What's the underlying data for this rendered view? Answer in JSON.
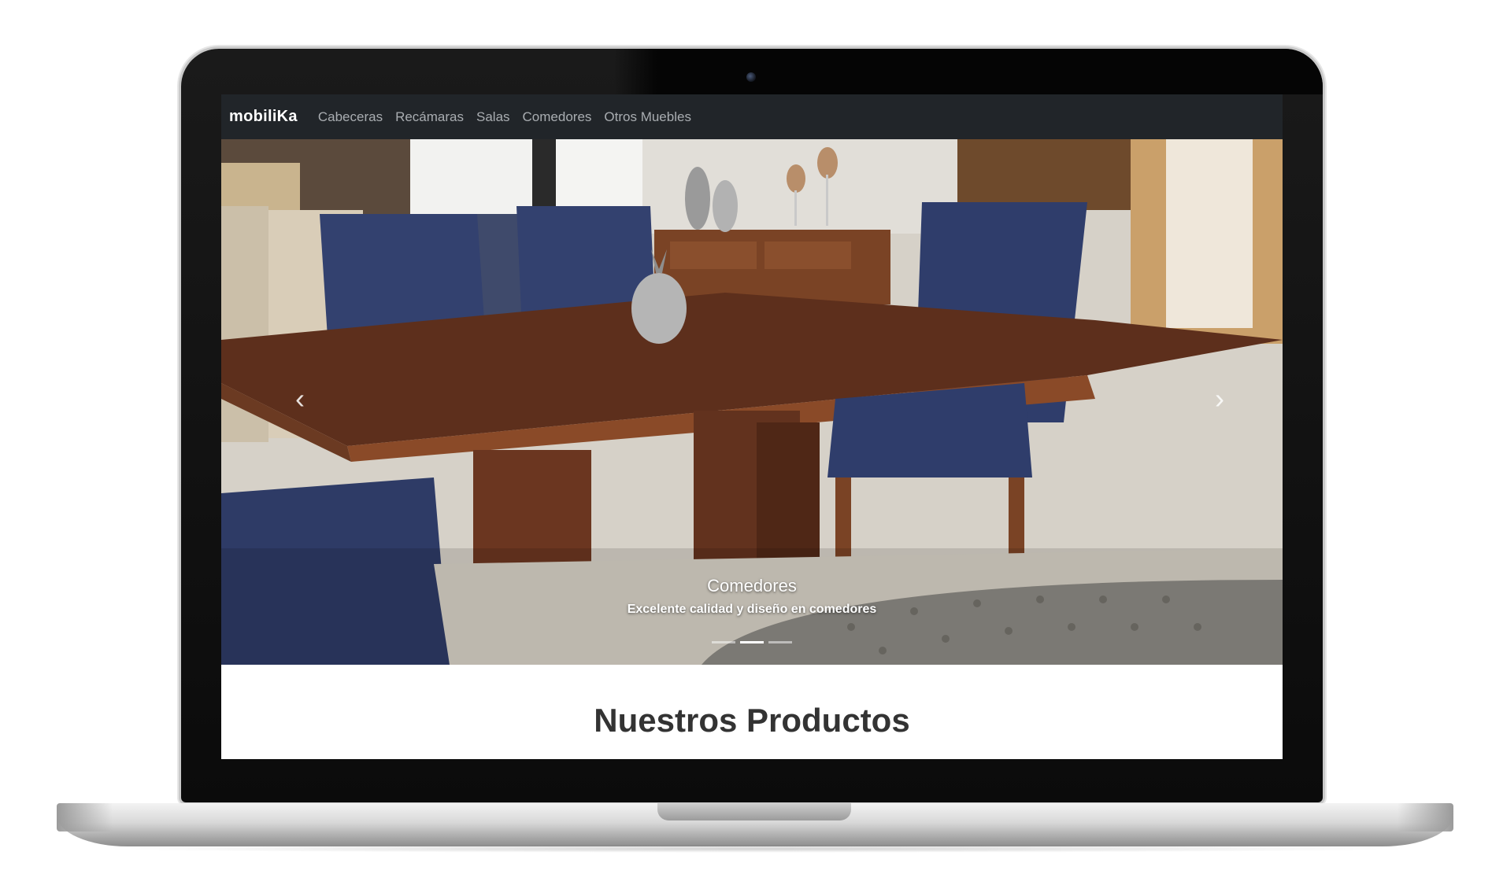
{
  "navbar": {
    "brand": "mobiliKa",
    "links": [
      "Cabeceras",
      "Recámaras",
      "Salas",
      "Comedores",
      "Otros Muebles"
    ]
  },
  "carousel": {
    "prev_icon": "chevron-left-icon",
    "next_icon": "chevron-right-icon",
    "caption_title": "Comedores",
    "caption_text": "Excelente calidad y diseño en comedores",
    "indicator_count": 3,
    "active_indicator": 2
  },
  "section": {
    "title": "Nuestros Productos"
  },
  "colors": {
    "navbar_bg": "#212529",
    "nav_link": "#a9adb1",
    "chair_blue": "#2f3f6e",
    "table_wood": "#6b3a22",
    "title_text": "#333333"
  }
}
